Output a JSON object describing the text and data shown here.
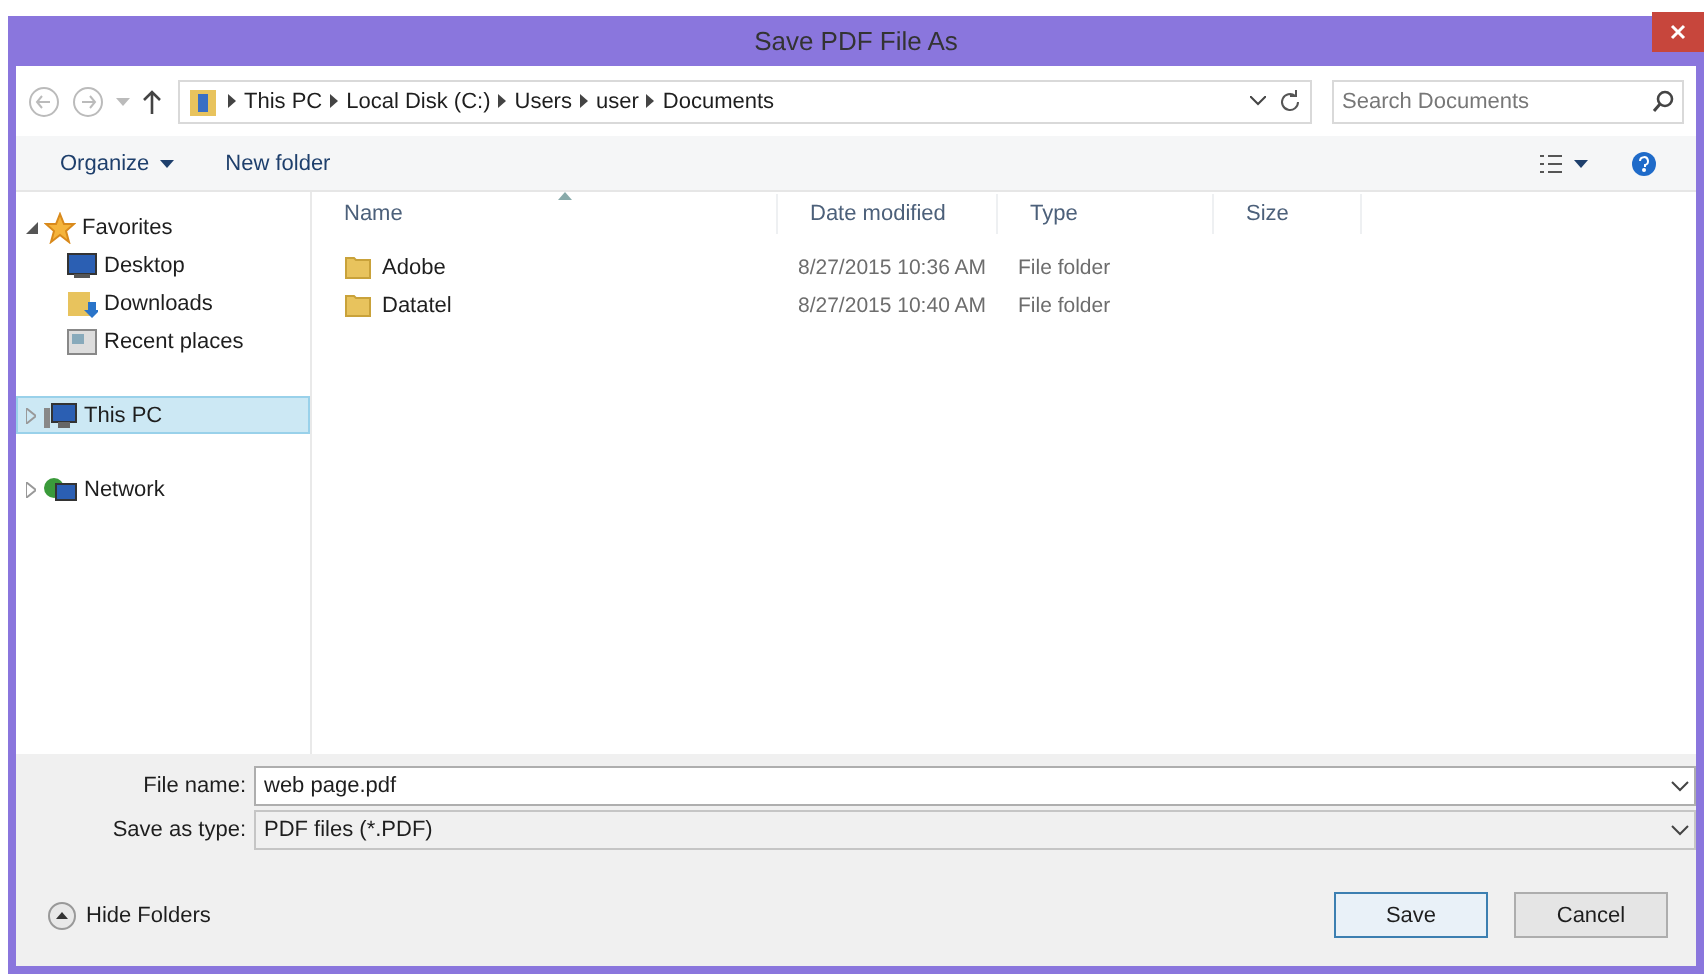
{
  "window": {
    "title": "Save PDF File As"
  },
  "address_bar": {
    "path": [
      "This PC",
      "Local Disk (C:)",
      "Users",
      "user",
      "Documents"
    ]
  },
  "search": {
    "placeholder": "Search Documents"
  },
  "toolbar": {
    "organize": "Organize",
    "new_folder": "New folder"
  },
  "sidebar": {
    "items": [
      {
        "label": "Favorites",
        "kind": "star",
        "expanded": true,
        "selected": false,
        "children": [
          {
            "label": "Desktop",
            "kind": "desktop",
            "selected": false
          },
          {
            "label": "Downloads",
            "kind": "downloads",
            "selected": false
          },
          {
            "label": "Recent places",
            "kind": "recent",
            "selected": false
          }
        ]
      },
      {
        "label": "This PC",
        "kind": "pc",
        "expanded": false,
        "selected": true
      },
      {
        "label": "Network",
        "kind": "network",
        "expanded": false,
        "selected": false
      }
    ]
  },
  "table": {
    "columns": [
      "Name",
      "Date modified",
      "Type",
      "Size"
    ],
    "rows": [
      {
        "name": "Adobe",
        "date": "8/27/2015 10:36 AM",
        "type": "File folder"
      },
      {
        "name": "Datatel",
        "date": "8/27/2015 10:40 AM",
        "type": "File folder"
      }
    ]
  },
  "file_name": {
    "label": "File name:",
    "value": "web page.pdf"
  },
  "save_type": {
    "label": "Save as type:",
    "value": "PDF files (*.PDF)"
  },
  "hide_folders": "Hide Folders",
  "buttons": [
    "Save",
    "Cancel"
  ]
}
